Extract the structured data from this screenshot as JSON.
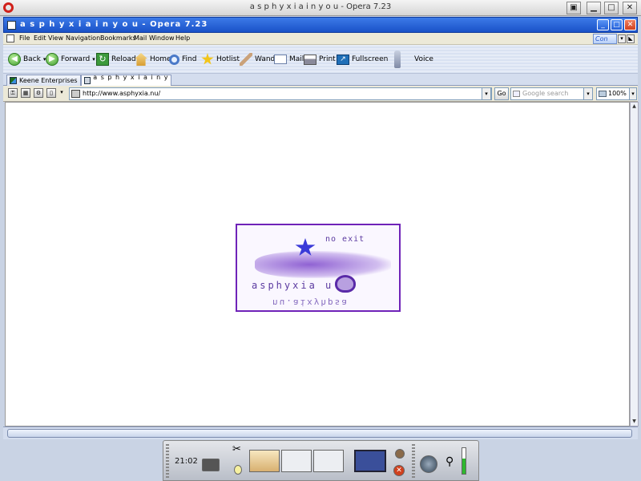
{
  "outer_window": {
    "title": "a s p h y x i a i n y o u - Opera 7.23"
  },
  "window": {
    "title": "a s p h y x i a i n y o u - Opera 7.23"
  },
  "menu": [
    {
      "label": "File"
    },
    {
      "label": "Edit"
    },
    {
      "label": "View"
    },
    {
      "label": "Navigation"
    },
    {
      "label": "Bookmarks"
    },
    {
      "label": "Mail"
    },
    {
      "label": "Window"
    },
    {
      "label": "Help"
    }
  ],
  "menu_combo": "Con",
  "toolbar": {
    "back": "Back",
    "forward": "Forward",
    "reload": "Reload",
    "home": "Home",
    "find": "Find",
    "hotlist": "Hotlist",
    "wand": "Wand",
    "mail": "Mail",
    "print": "Print",
    "fullscreen": "Fullscreen",
    "voice": "Voice"
  },
  "tabs": [
    {
      "label": "Keene Enterprises",
      "active": false
    },
    {
      "label": "a s p h y x i a i n y ...",
      "active": true
    }
  ],
  "address": {
    "url": "http://www.asphyxia.nu/",
    "go": "Go"
  },
  "search": {
    "placeholder": "Google search"
  },
  "zoom": "100%",
  "stamp": {
    "top_text": "no exit",
    "middle_text": "asphyxia  u",
    "bottom_text": "nu.aixyhpsa"
  },
  "taskbar": {
    "clock": "21:02"
  },
  "colors": {
    "titlebar": "#1a52c8",
    "stamp": "#6f23b8"
  }
}
